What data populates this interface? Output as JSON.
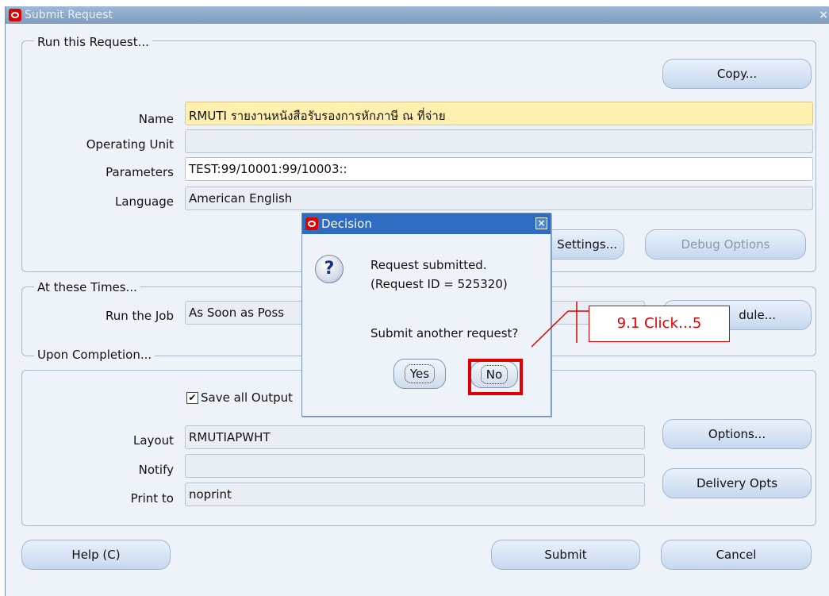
{
  "window": {
    "title": "Submit Request",
    "close": "×"
  },
  "run_group": {
    "legend": "Run this Request...",
    "copy_button": "Copy...",
    "name_label": "Name",
    "name_value": "RMUTI รายงานหนังสือรับรองการหักภาษี ณ ที่จ่าย",
    "operating_unit_label": "Operating Unit",
    "operating_unit_value": "",
    "parameters_label": "Parameters",
    "parameters_value": "TEST:99/10001:99/10003::",
    "language_label": "Language",
    "language_value": "American English",
    "settings_button": "Settings...",
    "debug_button": "Debug Options"
  },
  "times_group": {
    "legend": "At these Times...",
    "run_job_label": "Run the Job",
    "run_job_value": "As Soon as Poss",
    "schedule_button": "dule..."
  },
  "completion_group": {
    "legend": "Upon Completion...",
    "save_output_label": "Save all Output",
    "save_output_checked": true,
    "layout_label": "Layout",
    "layout_value": "RMUTIAPWHT",
    "notify_label": "Notify",
    "notify_value": "",
    "print_label": "Print to",
    "print_value": "noprint",
    "options_button": "Options...",
    "delivery_button": "Delivery Opts"
  },
  "footer": {
    "help_button": "Help (C)",
    "submit_button": "Submit",
    "cancel_button": "Cancel"
  },
  "dialog": {
    "title": "Decision",
    "close": "×",
    "line1": "Request submitted.",
    "line2": "(Request ID = 525320)",
    "question": "Submit another request?",
    "yes_button": "Yes",
    "no_button": "No"
  },
  "annotation": {
    "callout_text": "9.1 Click…5",
    "color": "#e00000"
  }
}
